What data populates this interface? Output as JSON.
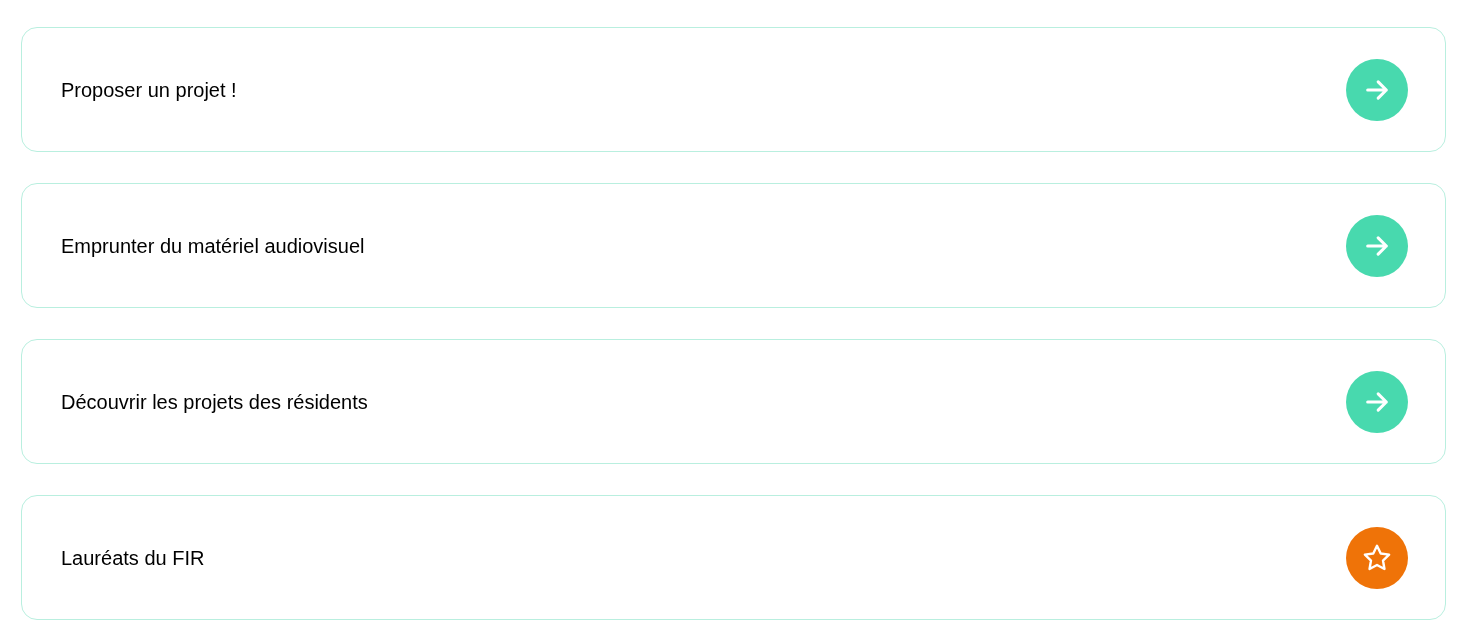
{
  "links": [
    {
      "label": "Proposer un projet !",
      "kind": "arrow"
    },
    {
      "label": "Emprunter du matériel audiovisuel",
      "kind": "arrow"
    },
    {
      "label": "Découvrir les projets des résidents",
      "kind": "arrow"
    },
    {
      "label": "Lauréats du FIR",
      "kind": "star"
    }
  ]
}
